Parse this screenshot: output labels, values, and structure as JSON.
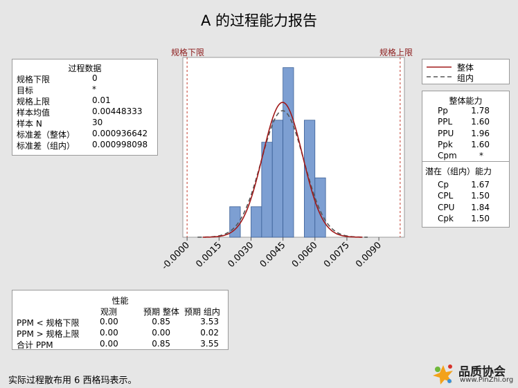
{
  "title": "A 的过程能力报告",
  "spec_labels": {
    "lsl": "规格下限",
    "usl": "规格上限"
  },
  "process_data": {
    "heading": "过程数据",
    "rows": [
      {
        "label": "规格下限",
        "value": "0"
      },
      {
        "label": "目标",
        "value": "*"
      },
      {
        "label": "规格上限",
        "value": "0.01"
      },
      {
        "label": "样本均值",
        "value": "0.00448333"
      },
      {
        "label": "样本 N",
        "value": "30"
      },
      {
        "label": "标准差（整体）",
        "value": "0.000936642"
      },
      {
        "label": "标准差（组内）",
        "value": "0.000998098"
      }
    ]
  },
  "legend": {
    "overall": "整体",
    "within": "组内"
  },
  "overall_capability": {
    "heading": "整体能力",
    "rows": [
      {
        "label": "Pp",
        "value": "1.78"
      },
      {
        "label": "PPL",
        "value": "1.60"
      },
      {
        "label": "PPU",
        "value": "1.96"
      },
      {
        "label": "Ppk",
        "value": "1.60"
      },
      {
        "label": "Cpm",
        "value": "*"
      }
    ]
  },
  "potential_capability": {
    "heading": "潜在（组内）能力",
    "rows": [
      {
        "label": "Cp",
        "value": "1.67"
      },
      {
        "label": "CPL",
        "value": "1.50"
      },
      {
        "label": "CPU",
        "value": "1.84"
      },
      {
        "label": "Cpk",
        "value": "1.50"
      }
    ]
  },
  "performance": {
    "heading": "性能",
    "col_headers": [
      "观测",
      "预期 整体",
      "预期 组内"
    ],
    "rows": [
      {
        "label": "PPM < 规格下限",
        "obs": "0.00",
        "exp_overall": "0.85",
        "exp_within": "3.53"
      },
      {
        "label": "PPM > 规格上限",
        "obs": "0.00",
        "exp_overall": "0.00",
        "exp_within": "0.02"
      },
      {
        "label": "合计 PPM",
        "obs": "0.00",
        "exp_overall": "0.85",
        "exp_within": "3.55"
      }
    ]
  },
  "footer": "实际过程散布用 6 西格玛表示。",
  "logo": {
    "name": "品质协会",
    "url": "www.PinZhi.org"
  },
  "colors": {
    "bar_fill": "#7d9fd2",
    "bar_stroke": "#3a5f96",
    "overall_curve": "#a01818",
    "within_curve": "#555555",
    "spec_line": "#c0392b"
  },
  "chart_data": {
    "type": "bar",
    "x_ticks": [
      "-0.0000",
      "0.0015",
      "0.0030",
      "0.0045",
      "0.0060",
      "0.0075",
      "0.0090"
    ],
    "tick_values": [
      0.0,
      0.0015,
      0.003,
      0.0045,
      0.006,
      0.0075,
      0.009
    ],
    "bins": [
      {
        "x0": 0.002,
        "x1": 0.0025,
        "value": 0.18
      },
      {
        "x0": 0.003,
        "x1": 0.0035,
        "value": 0.18
      },
      {
        "x0": 0.0035,
        "x1": 0.004,
        "value": 0.56
      },
      {
        "x0": 0.004,
        "x1": 0.0045,
        "value": 0.69
      },
      {
        "x0": 0.0045,
        "x1": 0.005,
        "value": 1.0
      },
      {
        "x0": 0.0055,
        "x1": 0.006,
        "value": 0.69
      },
      {
        "x0": 0.006,
        "x1": 0.0065,
        "value": 0.35
      }
    ],
    "overall_curve": {
      "mean": 0.00448333,
      "sd": 0.000936642
    },
    "within_curve": {
      "mean": 0.00448333,
      "sd": 0.000998098
    },
    "lsl": 0,
    "usl": 0.01,
    "xlim": [
      -0.0002,
      0.0102
    ],
    "ylim": [
      0,
      1.06
    ]
  }
}
